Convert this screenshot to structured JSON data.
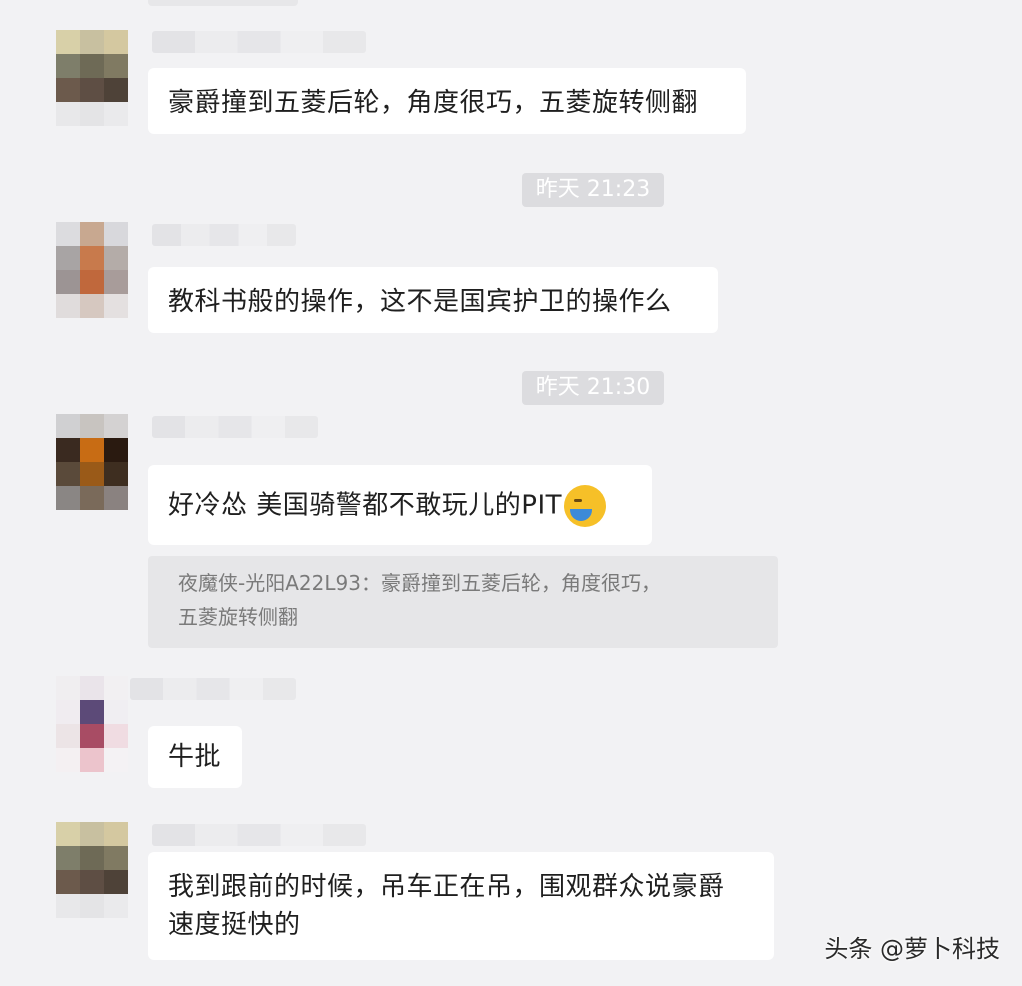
{
  "messages": [
    {
      "text": "豪爵撞到五菱后轮，角度很巧，五菱旋转侧翻"
    },
    {
      "text": "教科书般的操作，这不是国宾护卫的操作么"
    },
    {
      "text": "好冷怂 美国骑警都不敢玩儿的PIT",
      "emoji": "crying-laughing-emoji"
    },
    {
      "text": "牛批"
    },
    {
      "line1": "我到跟前的时候，吊车正在吊，围观群众说豪爵",
      "line2": "速度挺快的"
    }
  ],
  "timestamps": [
    "昨天 21:23",
    "昨天 21:30"
  ],
  "quote": {
    "line1": "夜魔侠-光阳A22L93：豪爵撞到五菱后轮，角度很巧，",
    "line2": "五菱旋转侧翻"
  },
  "watermark": "头条 @萝卜科技",
  "colors": {
    "background": "#f2f2f4",
    "bubble": "#ffffff",
    "timestamp_bg": "#dcdcdf",
    "quote_bg": "#e6e6e8"
  }
}
